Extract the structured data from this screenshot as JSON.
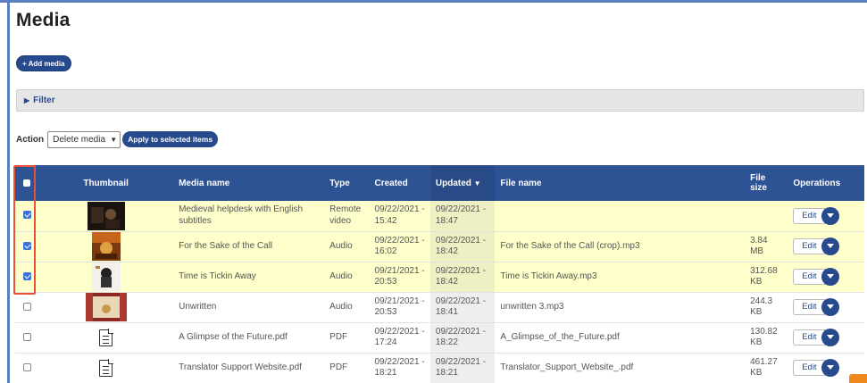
{
  "page": {
    "title": "Media"
  },
  "toolbar": {
    "add_media_label": "+ Add media"
  },
  "filter": {
    "label": "Filter"
  },
  "bulk_action": {
    "label": "Action",
    "selected_option": "Delete media",
    "apply_label": "Apply to selected items"
  },
  "table": {
    "headers": {
      "thumbnail": "Thumbnail",
      "media_name": "Media name",
      "type": "Type",
      "created": "Created",
      "updated": "Updated",
      "file_name": "File name",
      "file_size": "File size",
      "operations": "Operations"
    },
    "sort_indicator": "▼",
    "edit_label": "Edit",
    "rows": [
      {
        "selected": true,
        "thumb": "dark-video",
        "name": "Medieval helpdesk with English subtitles",
        "type": "Remote video",
        "created": "09/22/2021 - 15:42",
        "updated": "09/22/2021 - 18:47",
        "file": "",
        "size": ""
      },
      {
        "selected": true,
        "thumb": "orange-album",
        "name": "For the Sake of the Call",
        "type": "Audio",
        "created": "09/22/2021 - 16:02",
        "updated": "09/22/2021 - 18:42",
        "file": "For the Sake of the Call (crop).mp3",
        "size": "3.84 MB"
      },
      {
        "selected": true,
        "thumb": "white-album",
        "name": "Time is Tickin Away",
        "type": "Audio",
        "created": "09/21/2021 - 20:53",
        "updated": "09/22/2021 - 18:42",
        "file": "Time is Tickin Away.mp3",
        "size": "312.68 KB"
      },
      {
        "selected": false,
        "thumb": "stage-album",
        "name": "Unwritten",
        "type": "Audio",
        "created": "09/21/2021 - 20:53",
        "updated": "09/22/2021 - 18:41",
        "file": "unwritten 3.mp3",
        "size": "244.3 KB"
      },
      {
        "selected": false,
        "thumb": "document-icon",
        "name": "A Glimpse of the Future.pdf",
        "type": "PDF",
        "created": "09/22/2021 - 17:24",
        "updated": "09/22/2021 - 18:22",
        "file": "A_Glimpse_of_the_Future.pdf",
        "size": "130.82 KB"
      },
      {
        "selected": false,
        "thumb": "document-icon",
        "name": "Translator Support Website.pdf",
        "type": "PDF",
        "created": "09/22/2021 - 18:21",
        "updated": "09/22/2021 - 18:21",
        "file": "Translator_Support_Website_.pdf",
        "size": "461.27 KB"
      }
    ]
  },
  "colors": {
    "header_blue": "#2e5394",
    "button_blue": "#274a8c",
    "selected_row": "#ffffcc",
    "highlight_box": "#e8503a",
    "corner_badge": "#f18a1c"
  }
}
